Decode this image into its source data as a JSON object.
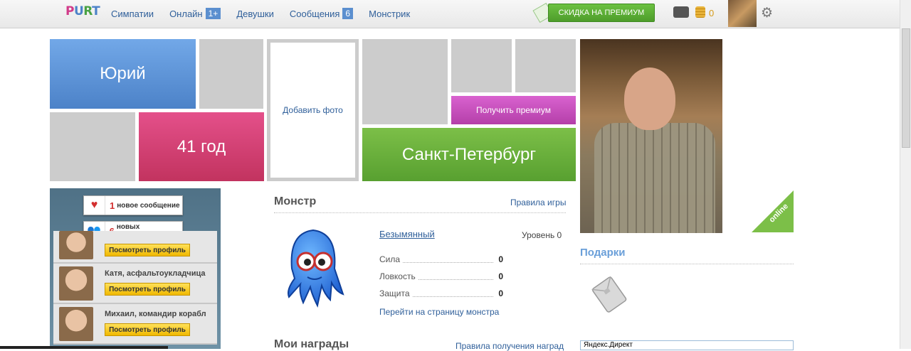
{
  "nav": {
    "items": [
      {
        "label": "Симпатии",
        "badge": ""
      },
      {
        "label": "Онлайн",
        "badge": "1+"
      },
      {
        "label": "Девушки",
        "badge": ""
      },
      {
        "label": "Сообщения",
        "badge": "6"
      },
      {
        "label": "Монстрик",
        "badge": ""
      }
    ],
    "premium_button": "СКИДКА НА ПРЕМИУМ",
    "coins": "0"
  },
  "profile": {
    "name": "Юрий",
    "age": "41 год",
    "city": "Санкт-Петербург",
    "add_photo": "Добавить фото",
    "get_premium": "Получить премиум",
    "status": "online"
  },
  "ads": {
    "notify_messages": {
      "count": "1",
      "label": "новое сообщение"
    },
    "notify_candidates": {
      "count": "6",
      "label": "новых кандидатов"
    },
    "candidates": [
      {
        "name": "",
        "button": "Посмотреть профиль"
      },
      {
        "name": "Катя, асфальтоукладчица",
        "button": "Посмотреть профиль"
      },
      {
        "name": "Михаил, командир корабл",
        "button": "Посмотреть профиль"
      }
    ]
  },
  "monster": {
    "title": "Монстр",
    "rules_link": "Правила игры",
    "name": "Безымянный",
    "level": "Уровень 0",
    "stats": [
      {
        "label": "Сила",
        "value": "0"
      },
      {
        "label": "Ловкость",
        "value": "0"
      },
      {
        "label": "Защита",
        "value": "0"
      }
    ],
    "page_link": "Перейти на страницу монстра"
  },
  "awards": {
    "title": "Мои награды",
    "rules_link": "Правила получения наград"
  },
  "gifts": {
    "title": "Подарки"
  },
  "yandex": "Яндекс.Директ"
}
